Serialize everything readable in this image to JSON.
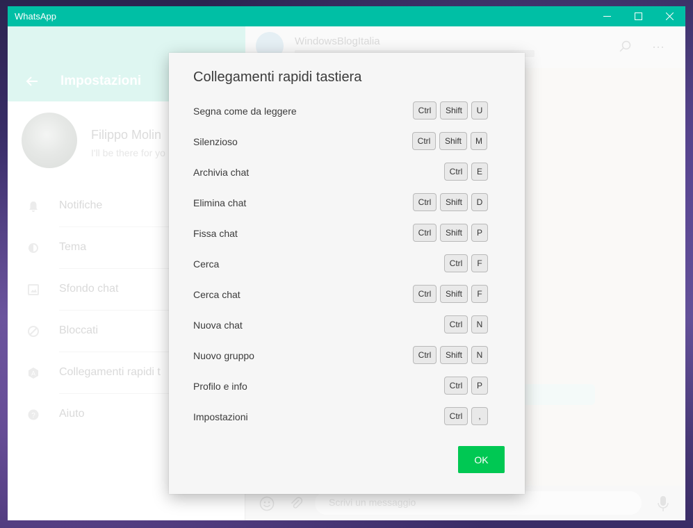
{
  "window": {
    "title": "WhatsApp",
    "accent": "#00bfa5",
    "controls": [
      "minimize-icon",
      "maximize-icon",
      "close-icon"
    ]
  },
  "settings": {
    "title": "Impostazioni",
    "profile": {
      "name": "Filippo Molin",
      "status": "I'll be there for yo"
    },
    "items": [
      {
        "label": "Notifiche",
        "icon": "bell-icon"
      },
      {
        "label": "Tema",
        "icon": "theme-icon"
      },
      {
        "label": "Sfondo chat",
        "icon": "wallpaper-icon"
      },
      {
        "label": "Bloccati",
        "icon": "blocked-icon"
      },
      {
        "label": "Collegamenti rapidi t",
        "icon": "keyboard-icon"
      },
      {
        "label": "Aiuto",
        "icon": "help-icon"
      }
    ]
  },
  "chat": {
    "name": "WindowsBlogItalia",
    "composer_placeholder": "Scrivi un messaggio"
  },
  "dialog": {
    "title": "Collegamenti rapidi tastiera",
    "ok_label": "OK",
    "ok_color": "#00c853",
    "shortcuts": [
      {
        "label": "Segna come da leggere",
        "keys": [
          "Ctrl",
          "Shift",
          "U"
        ]
      },
      {
        "label": "Silenzioso",
        "keys": [
          "Ctrl",
          "Shift",
          "M"
        ]
      },
      {
        "label": "Archivia chat",
        "keys": [
          "Ctrl",
          "E"
        ]
      },
      {
        "label": "Elimina chat",
        "keys": [
          "Ctrl",
          "Shift",
          "D"
        ]
      },
      {
        "label": "Fissa chat",
        "keys": [
          "Ctrl",
          "Shift",
          "P"
        ]
      },
      {
        "label": "Cerca",
        "keys": [
          "Ctrl",
          "F"
        ]
      },
      {
        "label": "Cerca chat",
        "keys": [
          "Ctrl",
          "Shift",
          "F"
        ]
      },
      {
        "label": "Nuova chat",
        "keys": [
          "Ctrl",
          "N"
        ]
      },
      {
        "label": "Nuovo gruppo",
        "keys": [
          "Ctrl",
          "Shift",
          "N"
        ]
      },
      {
        "label": "Profilo e info",
        "keys": [
          "Ctrl",
          "P"
        ]
      },
      {
        "label": "Impostazioni",
        "keys": [
          "Ctrl",
          ","
        ]
      }
    ]
  }
}
